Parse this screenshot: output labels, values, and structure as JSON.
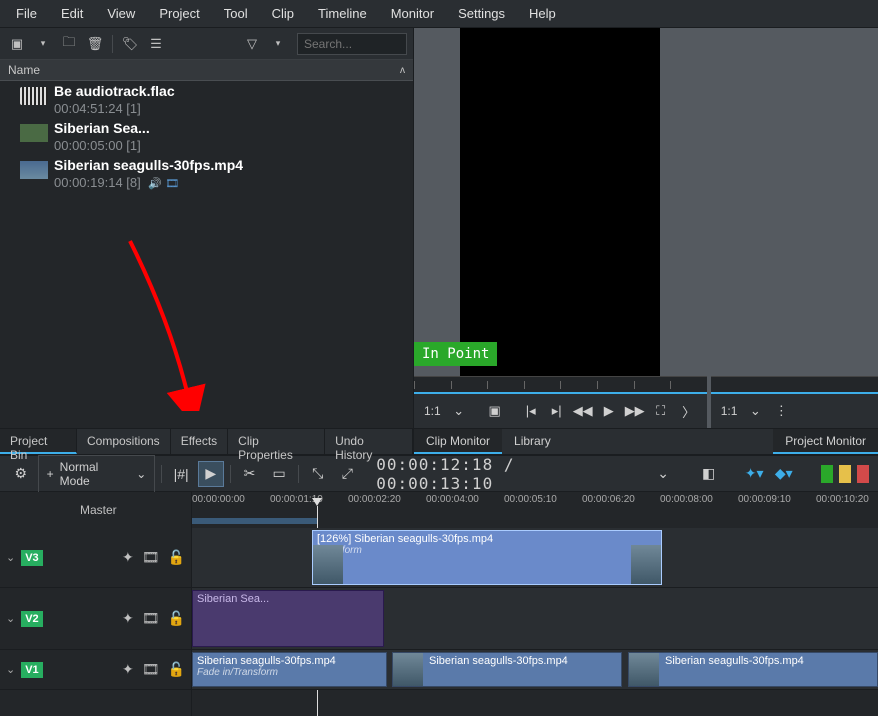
{
  "menubar": [
    "File",
    "Edit",
    "View",
    "Project",
    "Tool",
    "Clip",
    "Timeline",
    "Monitor",
    "Settings",
    "Help"
  ],
  "bin_toolbar": {
    "search_placeholder": "Search..."
  },
  "bin_header": {
    "name": "Name"
  },
  "bin_items": [
    {
      "title": "Be audiotrack.flac",
      "sub": "00:04:51:24 [1]",
      "thumb": "audio"
    },
    {
      "title": "Siberian Sea...",
      "sub": "00:00:05:00 [1]",
      "thumb": "img"
    },
    {
      "title": "Siberian seagulls-30fps.mp4",
      "sub": "00:00:19:14 [8]",
      "thumb": "vid",
      "badges": "🔊 🎞"
    }
  ],
  "bin_tabs": [
    "Project Bin",
    "Compositions",
    "Effects",
    "Clip Properties",
    "Undo History"
  ],
  "monitor_badge": "In Point",
  "monitor_ctrl": {
    "ratio": "1:1",
    "ratio2": "1:1"
  },
  "monitor_tabs_left": [
    "Clip Monitor",
    "Library"
  ],
  "monitor_tabs_right": [
    "Project Monitor"
  ],
  "timeline_toolbar": {
    "mode": "Normal Mode",
    "time": "00:00:12:18 / 00:00:13:10"
  },
  "timeline": {
    "master": "Master",
    "ruler_labels": [
      "00:00:00:00",
      "00:00:01:10",
      "00:00:02:20",
      "00:00:04:00",
      "00:00:05:10",
      "00:00:06:20",
      "00:00:08:00",
      "00:00:09:10",
      "00:00:10:20"
    ],
    "tracks": [
      {
        "id": "V3",
        "class": "h1"
      },
      {
        "id": "V2",
        "class": "h2"
      },
      {
        "id": "V1",
        "class": "h3"
      }
    ],
    "clips": {
      "v3": {
        "title": "[126%]  Siberian seagulls-30fps.mp4",
        "sub": "Transform"
      },
      "v2": {
        "title": "Siberian Sea..."
      },
      "v1a": {
        "title": "Siberian seagulls-30fps.mp4",
        "sub": "Fade in/Transform"
      },
      "v1b": {
        "title": "Siberian seagulls-30fps.mp4"
      },
      "v1c": {
        "title": "Siberian seagulls-30fps.mp4"
      }
    }
  }
}
